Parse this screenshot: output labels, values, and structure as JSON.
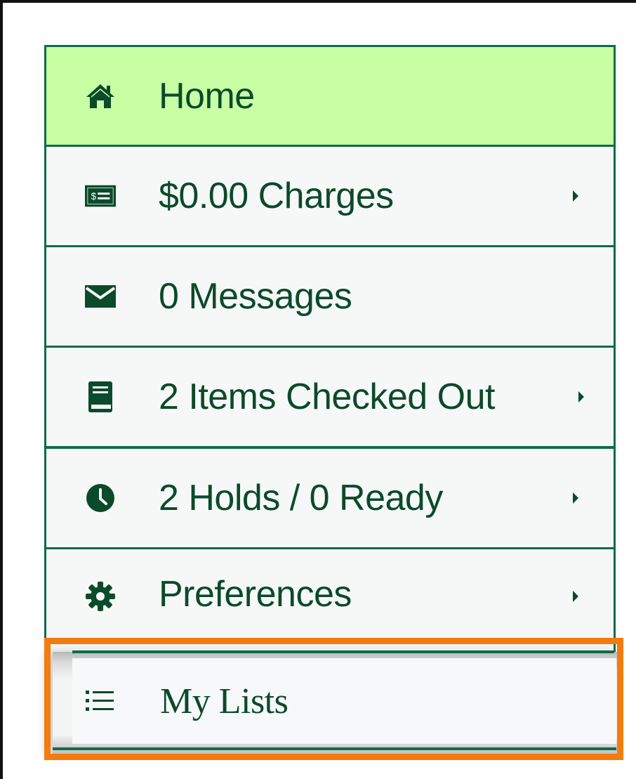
{
  "menu": {
    "items": [
      {
        "label": "Home",
        "icon": "home-icon",
        "active": true
      },
      {
        "label": "$0.00 Charges",
        "icon": "money-bill-icon",
        "has_submenu": true
      },
      {
        "label": "0 Messages",
        "icon": "envelope-icon"
      },
      {
        "label": "2 Items Checked Out",
        "icon": "book-icon",
        "has_submenu": true
      },
      {
        "label": "2 Holds / 0  Ready",
        "icon": "clock-icon",
        "has_submenu": true
      },
      {
        "label": "Preferences",
        "icon": "gear-icon",
        "has_submenu": true
      },
      {
        "label": "My Lists",
        "icon": "list-icon",
        "highlighted": true
      }
    ]
  },
  "colors": {
    "border": "#0e6b4b",
    "active_bg": "#c8ffa4",
    "item_bg": "#f6f8f8",
    "text": "#0b4a2a",
    "highlight": "#f47b0f"
  }
}
